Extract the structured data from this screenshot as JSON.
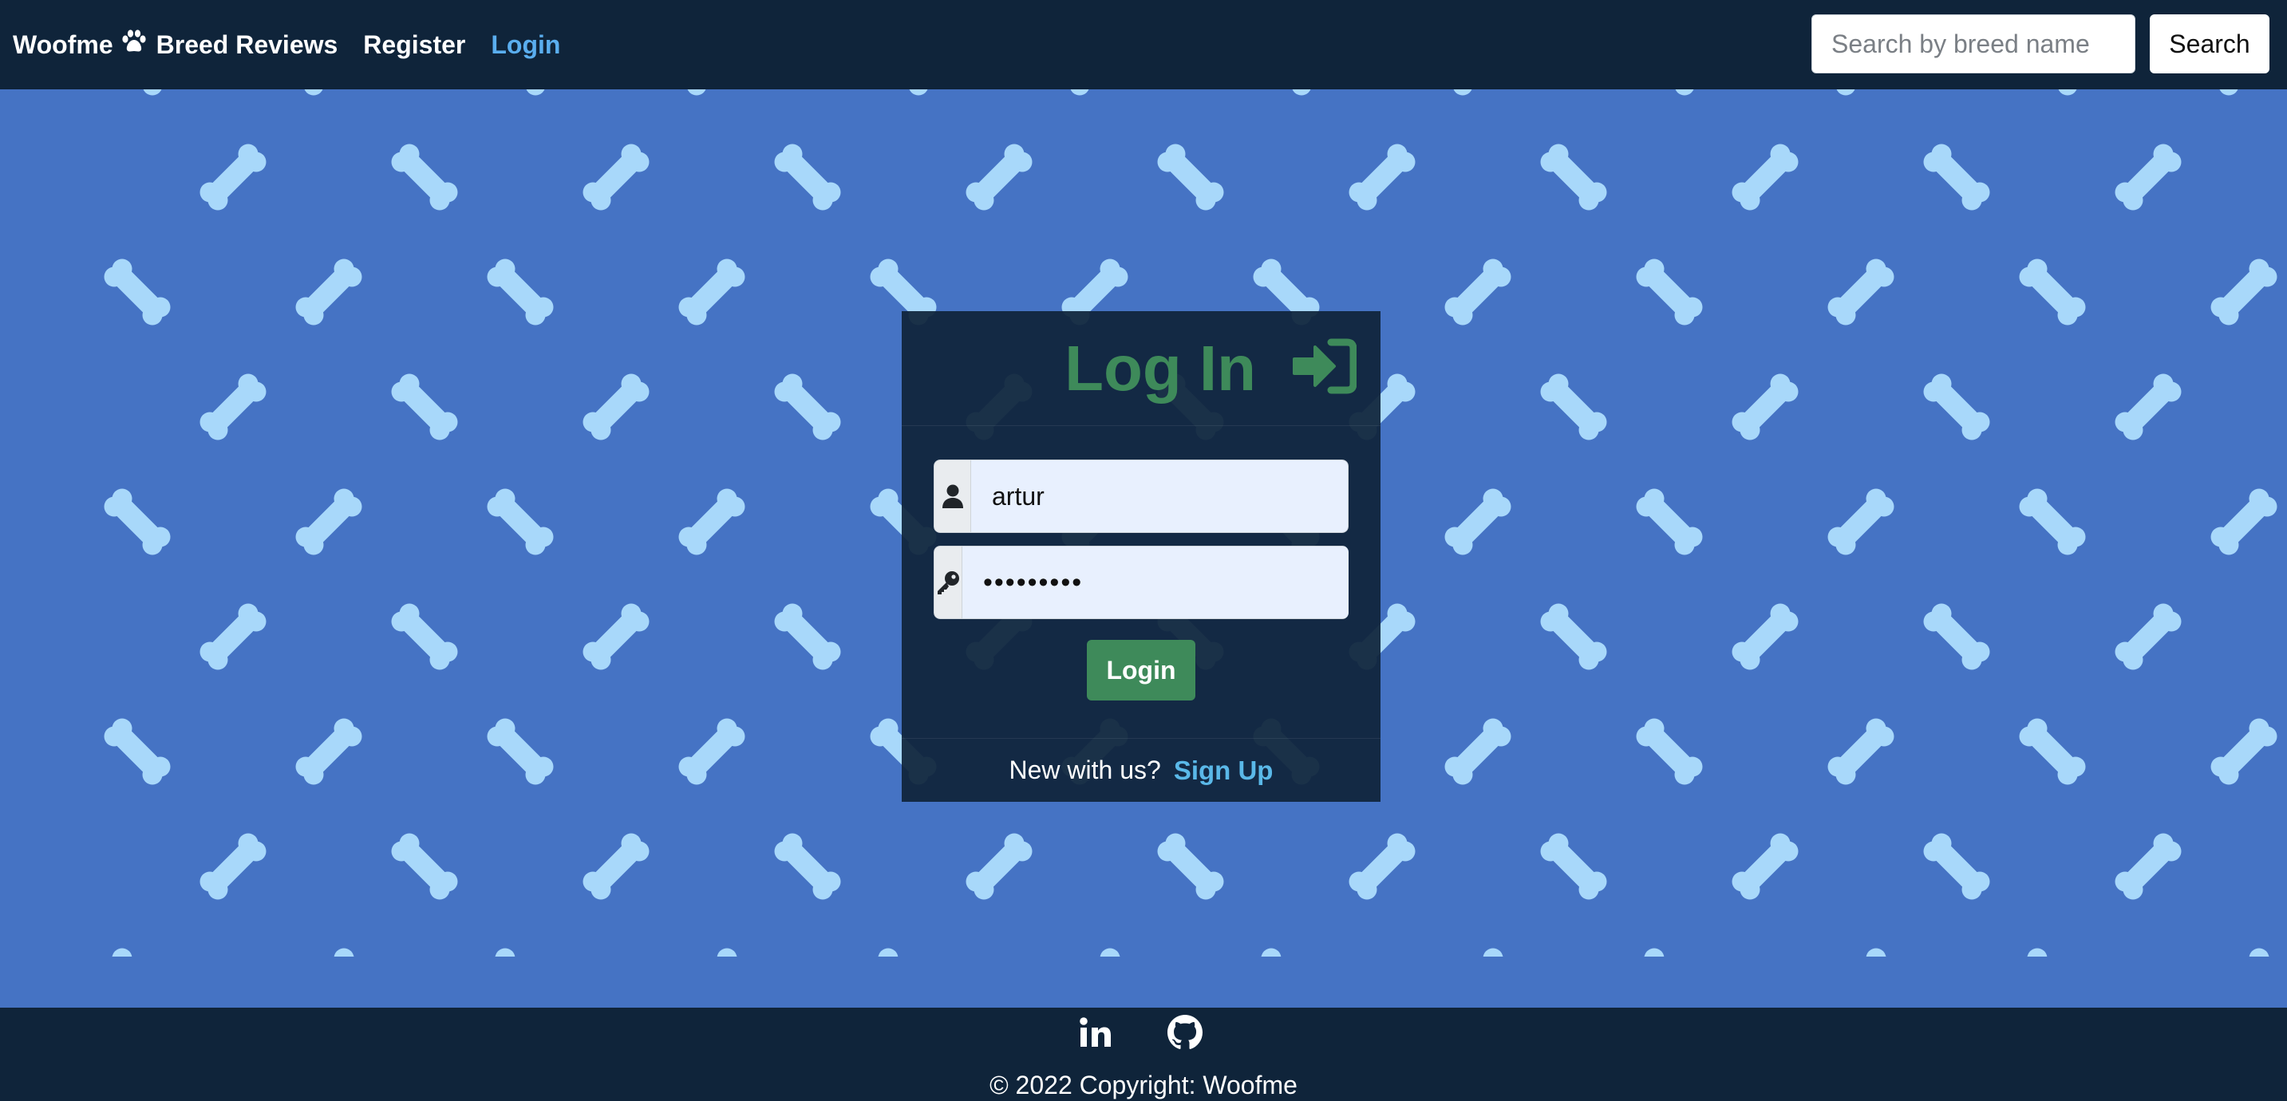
{
  "colors": {
    "navbar_bg": "#0f243a",
    "main_bg": "#4573c4",
    "bone": "#a8d8fa",
    "accent_green": "#3e8a5a",
    "link_blue": "#5aaeef",
    "signup_blue": "#5ab8e8"
  },
  "navbar": {
    "brand": "Woofme",
    "brand_icon": "paw-icon",
    "links": [
      {
        "label": "Breed Reviews"
      },
      {
        "label": "Register"
      },
      {
        "label": "Login"
      }
    ],
    "search": {
      "placeholder": "Search by breed name",
      "value": "",
      "button_label": "Search"
    }
  },
  "login_card": {
    "title": "Log In",
    "title_icon": "sign-in-icon",
    "username": {
      "icon": "user-icon",
      "value": "artur"
    },
    "password": {
      "icon": "key-icon",
      "value": "•••••••••"
    },
    "submit_label": "Login",
    "footer_text": "New with us?",
    "signup_label": "Sign Up"
  },
  "footer": {
    "icons": [
      "linkedin-icon",
      "github-icon"
    ],
    "copyright": "© 2022 Copyright: Woofme"
  }
}
